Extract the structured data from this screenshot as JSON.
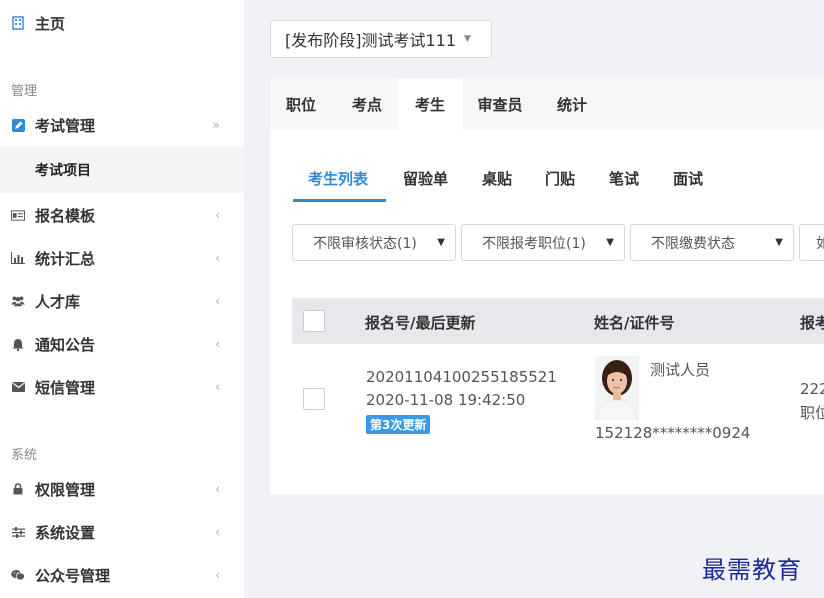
{
  "sidebar": {
    "home": "主页",
    "section_manage": "管理",
    "exam_manage": "考试管理",
    "exam_project": "考试项目",
    "items": [
      {
        "label": "报名模板",
        "icon": "id-card-icon"
      },
      {
        "label": "统计汇总",
        "icon": "bar-chart-icon"
      },
      {
        "label": "人才库",
        "icon": "users-icon"
      },
      {
        "label": "通知公告",
        "icon": "bell-icon"
      },
      {
        "label": "短信管理",
        "icon": "envelope-icon"
      }
    ],
    "section_system": "系统",
    "system_items": [
      {
        "label": "权限管理",
        "icon": "lock-icon"
      },
      {
        "label": "系统设置",
        "icon": "sliders-icon"
      },
      {
        "label": "公众号管理",
        "icon": "wechat-icon"
      }
    ]
  },
  "stage_select": {
    "value": "[发布阶段]测试考试111"
  },
  "tabs": [
    "职位",
    "考点",
    "考生",
    "审查员",
    "统计"
  ],
  "subtabs": [
    "考生列表",
    "留验单",
    "桌贴",
    "门贴",
    "笔试",
    "面试"
  ],
  "filters": [
    "不限审核状态(1)",
    "不限报考职位(1)",
    "不限缴费状态",
    "如"
  ],
  "table": {
    "headers": [
      "报名号/最后更新",
      "姓名/证件号",
      "报考"
    ],
    "rows": [
      {
        "reg_no": "20201104100255185521",
        "updated": "2020-11-08 19:42:50",
        "badge": "第3次更新",
        "name": "测试人员",
        "id_no": "152128********0924",
        "apply_code": "222",
        "apply_label": "职位"
      }
    ]
  },
  "watermark": "最需教育"
}
